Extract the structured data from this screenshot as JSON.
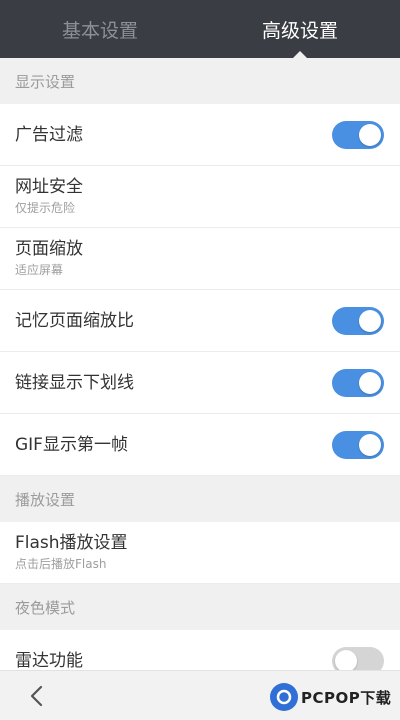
{
  "tabs": [
    {
      "label": "基本设置",
      "active": false
    },
    {
      "label": "高级设置",
      "active": true
    }
  ],
  "sections": {
    "display": {
      "header": "显示设置",
      "ad_filter": {
        "title": "广告过滤",
        "toggle": "on"
      },
      "url_security": {
        "title": "网址安全",
        "subtitle": "仅提示危险"
      },
      "page_zoom": {
        "title": "页面缩放",
        "subtitle": "适应屏幕"
      },
      "remember_zoom": {
        "title": "记忆页面缩放比",
        "toggle": "on"
      },
      "link_underline": {
        "title": "链接显示下划线",
        "toggle": "on"
      },
      "gif_first_frame": {
        "title": "GIF显示第一帧",
        "toggle": "on"
      }
    },
    "playback": {
      "header": "播放设置",
      "flash": {
        "title": "Flash播放设置",
        "subtitle": "点击后播放Flash"
      }
    },
    "night": {
      "header": "夜色模式",
      "radar": {
        "title": "雷达功能",
        "toggle": "off"
      }
    }
  },
  "bottom": {
    "back_icon": "chevron-left-icon",
    "logo_text": "PCPOP下载"
  },
  "colors": {
    "tabbar": "#3a3d44",
    "toggle_on": "#4a90e2",
    "toggle_off": "#d5d5d5",
    "background": "#f0f0f0"
  }
}
